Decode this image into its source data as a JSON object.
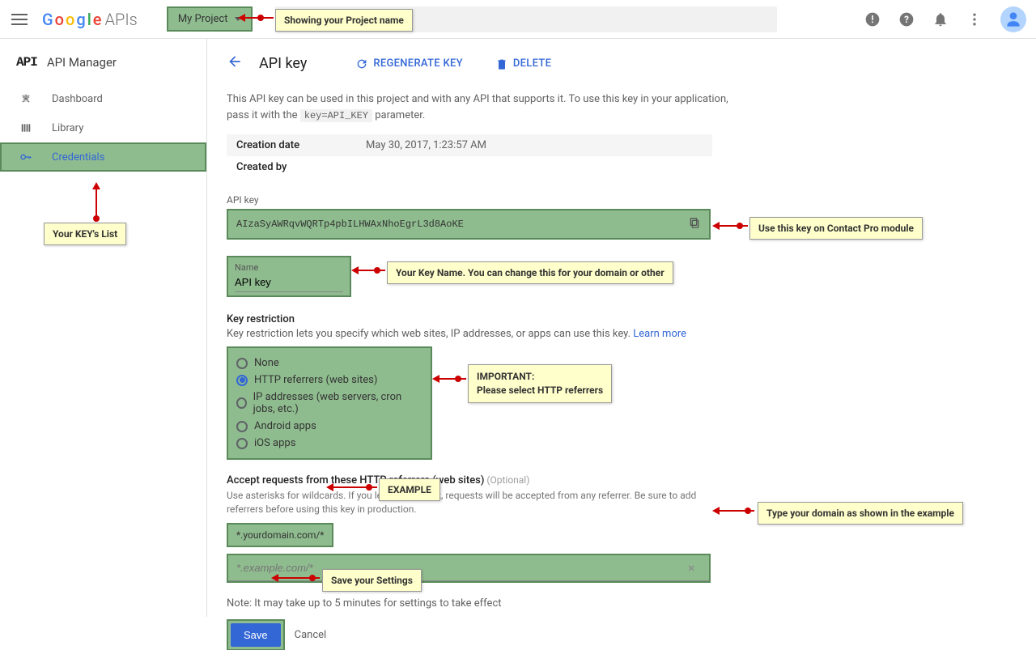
{
  "topbar": {
    "logo_apis": "APIs",
    "project_label": "My Project",
    "search_placeholder": ""
  },
  "sidebar": {
    "api_ic": "API",
    "title": "API Manager",
    "items": [
      {
        "label": "Dashboard"
      },
      {
        "label": "Library"
      },
      {
        "label": "Credentials"
      }
    ]
  },
  "page": {
    "title": "API key",
    "regen": "Regenerate Key",
    "delete": "Delete",
    "desc_line1": "This API key can be used in this project and with any API that supports it. To use this key in your application,",
    "desc_line2a": "pass it with the ",
    "desc_code": "key=API_KEY",
    "desc_line2b": " parameter.",
    "meta": {
      "creation_k": "Creation date",
      "creation_v": "May 30, 2017, 1:23:57 AM",
      "createdby_k": "Created by"
    },
    "apikey_label": "API key",
    "apikey_value": "AIzaSyAWRqvWQRTp4pbILHWAxNhoEgrL3d8AoKE",
    "name_label": "Name",
    "name_value": "API key",
    "kr_head": "Key restriction",
    "kr_desc": "Key restriction lets you specify which web sites, IP addresses, or apps can use this key. ",
    "kr_learn": "Learn more",
    "radios": [
      "None",
      "HTTP referrers (web sites)",
      "IP addresses (web servers, cron jobs, etc.)",
      "Android apps",
      "iOS apps"
    ],
    "accept_head": "Accept requests from these HTTP referrers (web sites)",
    "accept_opt": " (Optional)",
    "accept_desc": "Use asterisks for wildcards. If you leave this blank, requests will be accepted from any referrer. Be sure to add referrers before using this key in production.",
    "chip": "*.yourdomain.com/*",
    "ref_placeholder": "*.example.com/*",
    "note": "Note: It may take up to 5 minutes for settings to take effect",
    "save": "Save",
    "cancel": "Cancel"
  },
  "annotations": {
    "project": "Showing your Project name",
    "keys_list": "Your KEY's List",
    "use_key": "Use this key on Contact Pro module",
    "key_name": "Your Key Name. You can change this for your domain or other",
    "important_l1": "IMPORTANT:",
    "important_l2": "Please select HTTP referrers",
    "example": "EXAMPLE",
    "type_domain": "Type your domain as shown in the example",
    "save_settings": "Save your Settings"
  }
}
